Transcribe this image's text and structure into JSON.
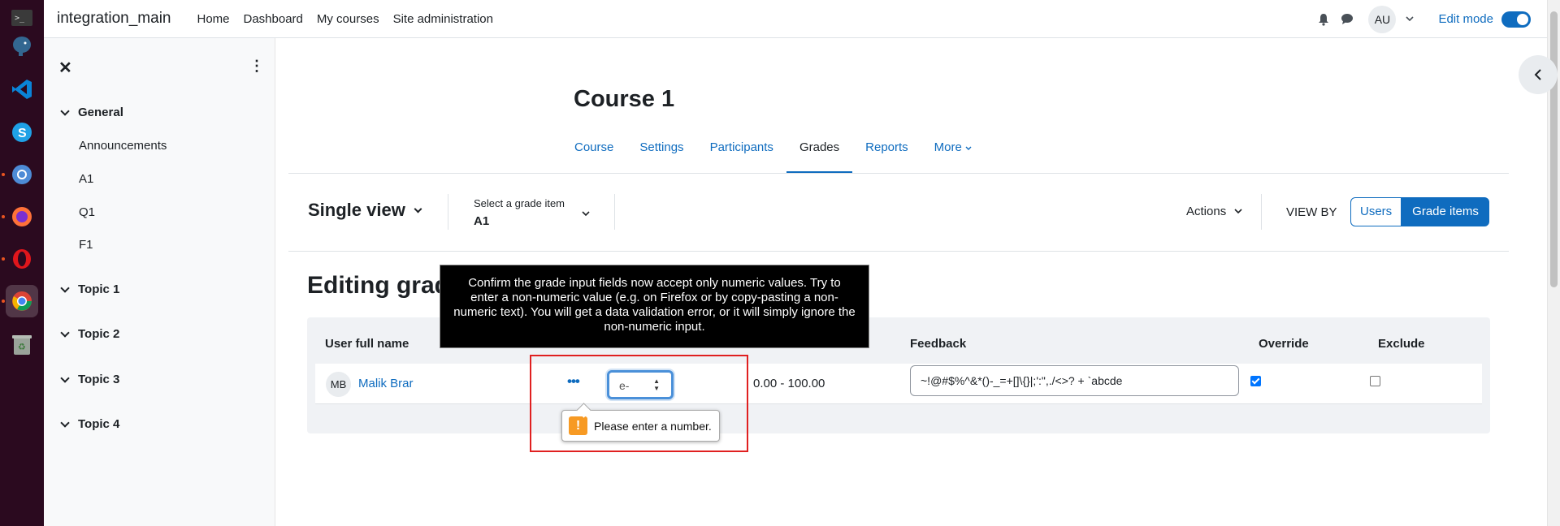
{
  "dock": {
    "items": [
      "terminal-icon",
      "postgres-elephant-icon",
      "vscode-icon",
      "skype-icon",
      "chromium-icon",
      "firefox-icon",
      "opera-icon",
      "chrome-icon",
      "trash-icon"
    ]
  },
  "topnav": {
    "site_name": "integration_main",
    "links": [
      "Home",
      "Dashboard",
      "My courses",
      "Site administration"
    ],
    "avatar_initials": "AU",
    "edit_mode_label": "Edit mode"
  },
  "drawer": {
    "sections": [
      {
        "title": "General",
        "items": [
          "Announcements",
          "A1",
          "Q1",
          "F1"
        ]
      },
      {
        "title": "Topic 1",
        "items": []
      },
      {
        "title": "Topic 2",
        "items": []
      },
      {
        "title": "Topic 3",
        "items": []
      },
      {
        "title": "Topic 4",
        "items": []
      }
    ]
  },
  "course": {
    "title": "Course 1",
    "tabs": [
      "Course",
      "Settings",
      "Participants",
      "Grades",
      "Reports",
      "More"
    ],
    "active_tab": "Grades"
  },
  "toolbar": {
    "single_view_label": "Single view",
    "grade_item_label": "Select a grade item",
    "grade_item_value": "A1",
    "actions_label": "Actions",
    "view_by_label": "VIEW BY",
    "users_label": "Users",
    "grade_items_label": "Grade items"
  },
  "editing": {
    "title_visible": "Editing grad"
  },
  "table": {
    "headers": {
      "user_full_name": "User full name",
      "feedback": "Feedback",
      "override": "Override",
      "exclude": "Exclude"
    },
    "row": {
      "initials": "MB",
      "name": "Malik Brar",
      "grade_value": "e-",
      "range": "0.00 - 100.00",
      "feedback": "~!@#$%^&*()-_=+[]\\{}|;':\",./<>? + `abcde",
      "override_checked": true,
      "exclude_checked": false
    }
  },
  "validation": {
    "message": "Please enter a number."
  },
  "annotation": {
    "text": "Confirm the grade input fields now accept only numeric values. Try to enter a non-numeric value (e.g. on Firefox or by copy-pasting a non-numeric text). You will get a data validation error, or it will simply ignore the non-numeric input."
  },
  "colors": {
    "link": "#0f6cbf",
    "dock_bg": "#2b0a1f",
    "warning": "#f79a24",
    "annotation_border": "#e02020"
  }
}
